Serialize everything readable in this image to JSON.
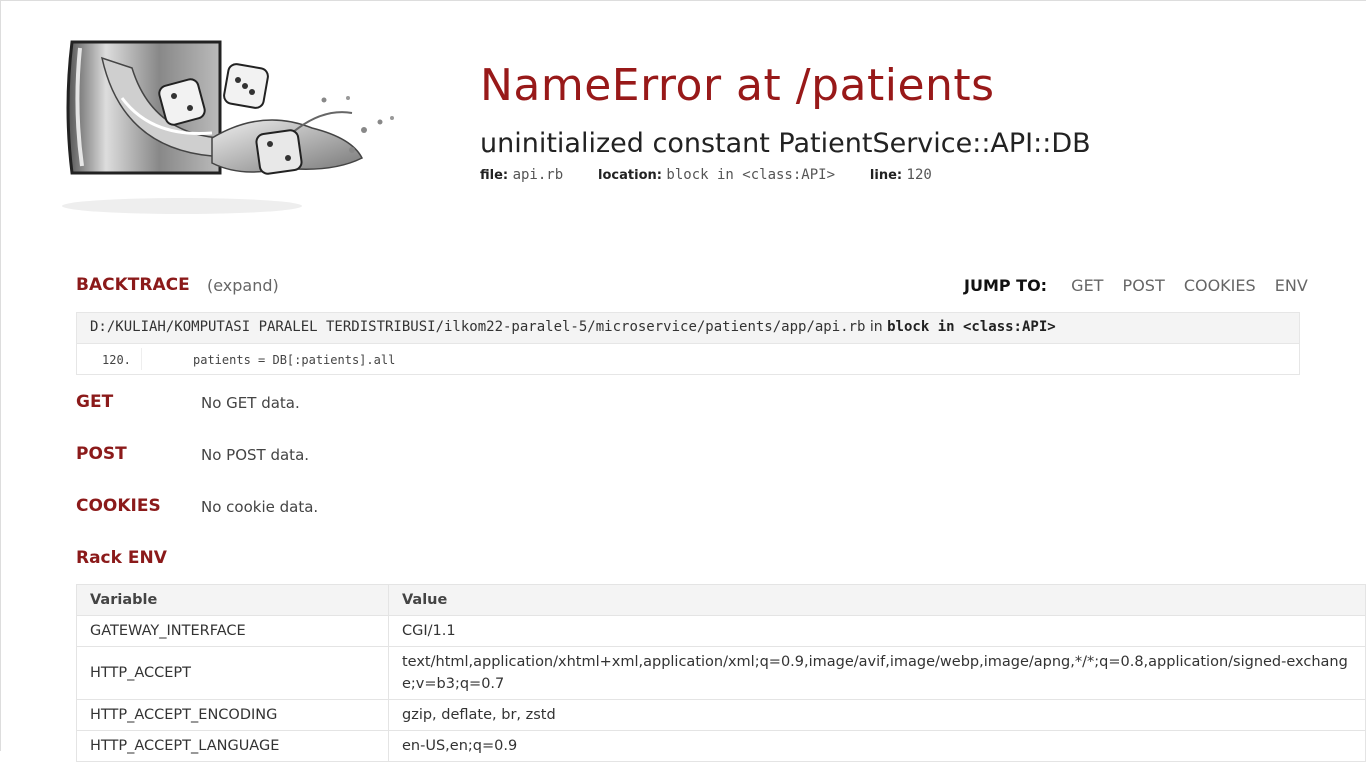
{
  "header": {
    "title": "NameError at /patients",
    "message": "uninitialized constant PatientService::API::DB",
    "file_label": "file:",
    "file_value": "api.rb",
    "location_label": "location:",
    "location_value": "block in <class:API>",
    "line_label": "line:",
    "line_value": "120"
  },
  "logo": {
    "icon": "dice-splash-logo"
  },
  "backtrace": {
    "title": "BACKTRACE",
    "expand_label": "(expand)",
    "frame_path": "D:/KULIAH/KOMPUTASI PARALEL TERDISTRIBUSI/ilkom22-paralel-5/microservice/patients/app/api.rb",
    "frame_in": "in",
    "frame_function": "block in <class:API>",
    "line_number": "120.",
    "code": "patients = DB[:patients].all"
  },
  "jump_to": {
    "label": "JUMP TO:",
    "links": [
      "GET",
      "POST",
      "COOKIES",
      "ENV"
    ]
  },
  "sections": {
    "get": {
      "title": "GET",
      "empty": "No GET data."
    },
    "post": {
      "title": "POST",
      "empty": "No POST data."
    },
    "cookies": {
      "title": "COOKIES",
      "empty": "No cookie data."
    }
  },
  "rack_env": {
    "title": "Rack ENV",
    "col_variable": "Variable",
    "col_value": "Value",
    "rows": [
      {
        "variable": "GATEWAY_INTERFACE",
        "value": "CGI/1.1"
      },
      {
        "variable": "HTTP_ACCEPT",
        "value": "text/html,application/xhtml+xml,application/xml;q=0.9,image/avif,image/webp,image/apng,*/*;q=0.8,application/signed-exchange;v=b3;q=0.7"
      },
      {
        "variable": "HTTP_ACCEPT_ENCODING",
        "value": "gzip, deflate, br, zstd"
      },
      {
        "variable": "HTTP_ACCEPT_LANGUAGE",
        "value": "en-US,en;q=0.9"
      }
    ]
  },
  "colors": {
    "accent": "#981919",
    "section": "#8b1a1a"
  }
}
